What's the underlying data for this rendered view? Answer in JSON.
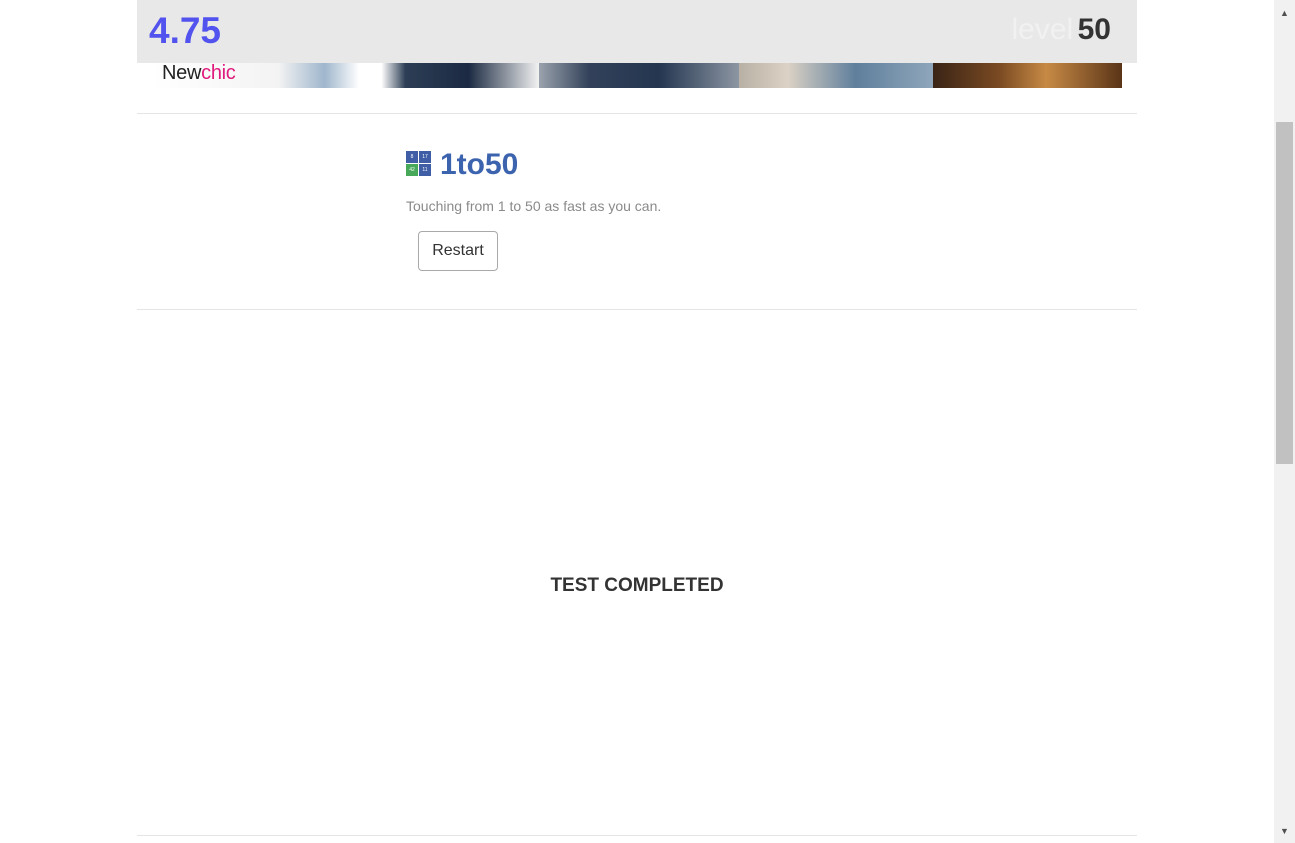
{
  "topbar": {
    "score": "4.75",
    "level_label": "level",
    "level_value": "50"
  },
  "ad": {
    "logo_new": "New",
    "logo_chic": "chic"
  },
  "header": {
    "icon_numbers": [
      "8",
      "17",
      "42",
      "11"
    ],
    "title": "1to50",
    "subtitle": "Touching from 1 to 50 as fast as you can.",
    "restart_label": "Restart"
  },
  "game": {
    "status": "TEST COMPLETED"
  },
  "colors": {
    "score": "#5252ee",
    "title": "#3c63ae",
    "topbar_bg": "#e8e8e8",
    "newchic_pink": "#e0197d"
  },
  "scrollbar": {
    "up_icon": "up-arrow-icon",
    "down_icon": "down-arrow-icon"
  }
}
